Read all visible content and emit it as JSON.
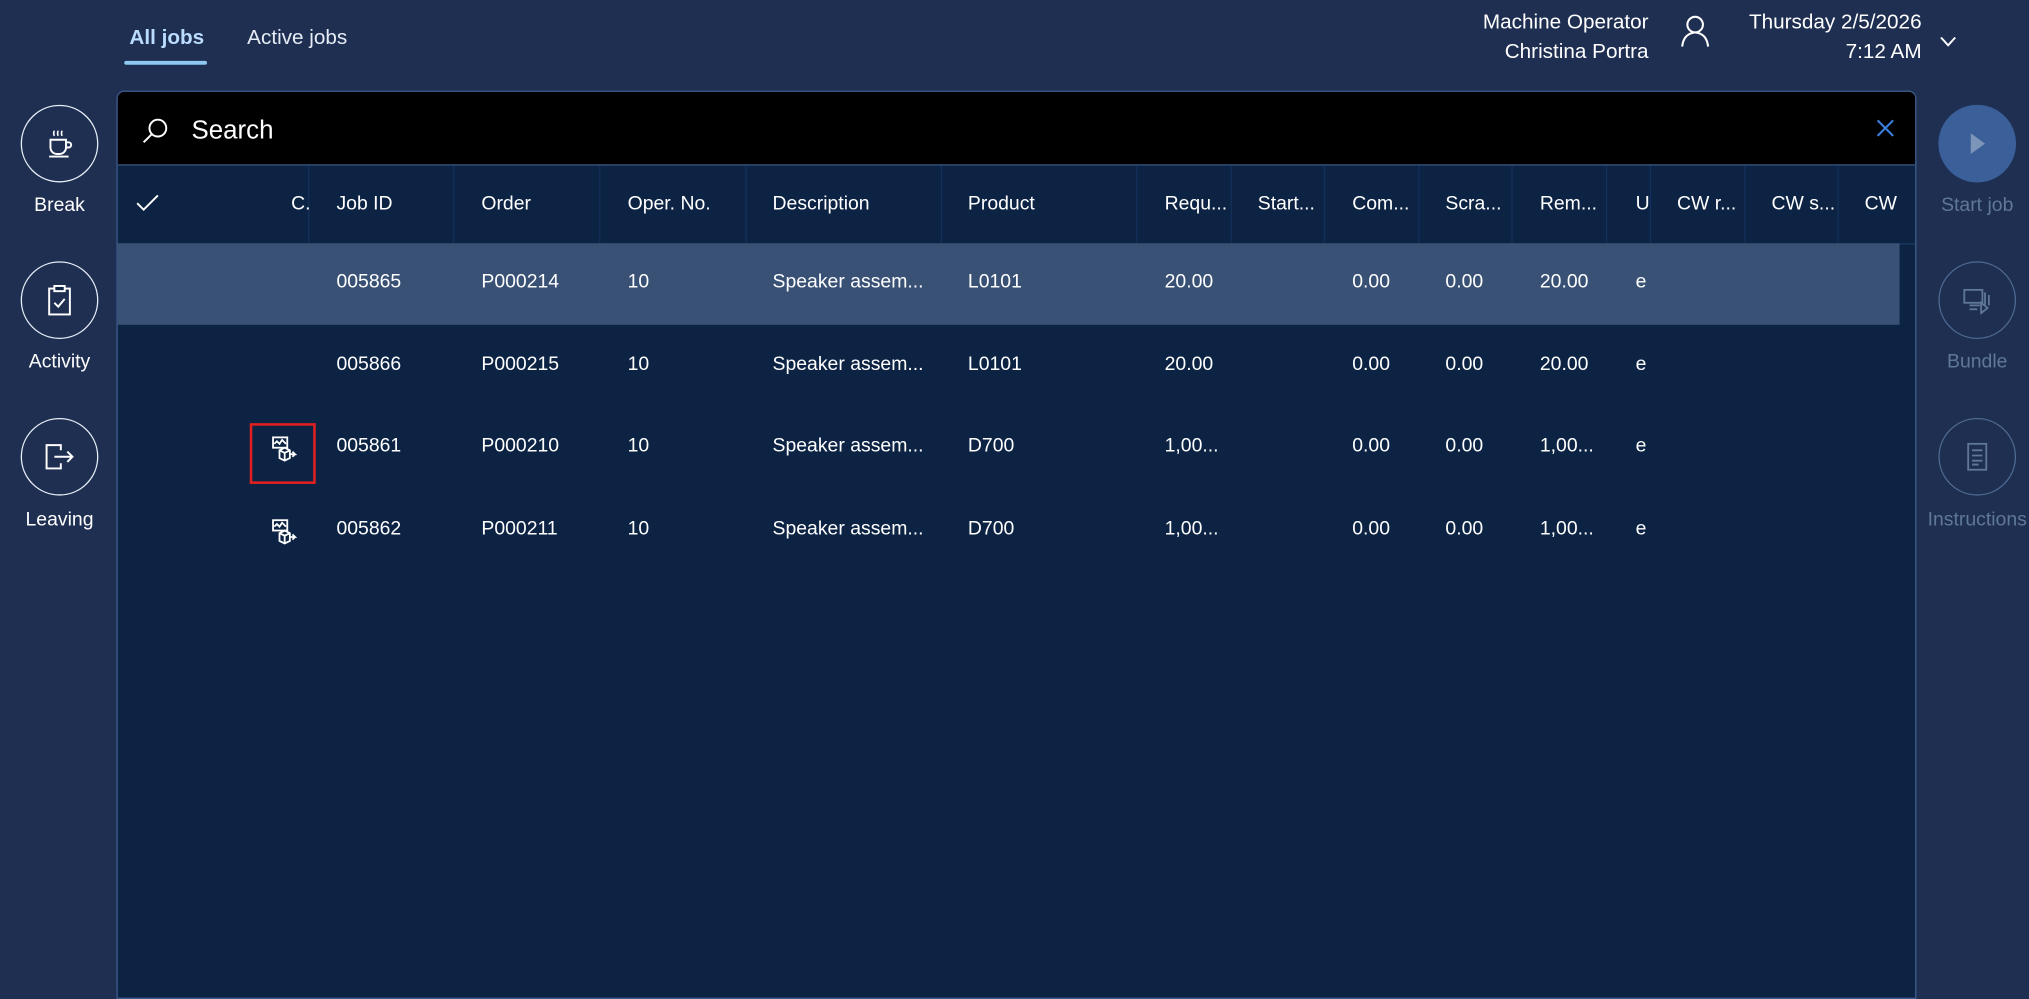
{
  "tabs": [
    {
      "label": "All jobs",
      "active": true
    },
    {
      "label": "Active jobs",
      "active": false
    }
  ],
  "user": {
    "role": "Machine Operator",
    "name": "Christina Portra",
    "icon": "person-icon"
  },
  "datetime": {
    "date": "Thursday 2/5/2026",
    "time": "7:12 AM"
  },
  "search": {
    "placeholder": "Search"
  },
  "left_actions": [
    {
      "label": "Break",
      "icon": "coffee-icon"
    },
    {
      "label": "Activity",
      "icon": "clipboard-check-icon"
    },
    {
      "label": "Leaving",
      "icon": "exit-icon"
    }
  ],
  "right_actions": [
    {
      "label": "Start job",
      "icon": "play-icon",
      "enabled": false
    },
    {
      "label": "Bundle",
      "icon": "bundle-icon",
      "enabled": false
    },
    {
      "label": "Instructions",
      "icon": "document-list-icon",
      "enabled": false
    }
  ],
  "table": {
    "columns": [
      "C.",
      "Job ID",
      "Order",
      "Oper. No.",
      "Description",
      "Product",
      "Requ...",
      "Start...",
      "Com...",
      "Scra...",
      "Rem...",
      "U",
      "CW r...",
      "CW s...",
      "CW"
    ],
    "rows": [
      {
        "selected": true,
        "icon": false,
        "cells": [
          "005865",
          "P000214",
          "10",
          "Speaker assem...",
          "L0101",
          "20.00",
          "",
          "0.00",
          "0.00",
          "20.00",
          "e",
          "",
          "",
          ""
        ]
      },
      {
        "selected": false,
        "icon": false,
        "cells": [
          "005866",
          "P000215",
          "10",
          "Speaker assem...",
          "L0101",
          "20.00",
          "",
          "0.00",
          "0.00",
          "20.00",
          "e",
          "",
          "",
          ""
        ]
      },
      {
        "selected": false,
        "icon": true,
        "highlighted": true,
        "cells": [
          "005861",
          "P000210",
          "10",
          "Speaker assem...",
          "D700",
          "1,00...",
          "",
          "0.00",
          "0.00",
          "1,00...",
          "e",
          "",
          "",
          ""
        ]
      },
      {
        "selected": false,
        "icon": true,
        "cells": [
          "005862",
          "P000211",
          "10",
          "Speaker assem...",
          "D700",
          "1,00...",
          "",
          "0.00",
          "0.00",
          "1,00...",
          "e",
          "",
          "",
          ""
        ]
      }
    ]
  },
  "colors": {
    "background": "#1f2f52",
    "panel": "#0c2344",
    "selected_row": "#3a5176",
    "tab_accent": "#8cc8f0",
    "highlight_box": "#e02020"
  }
}
